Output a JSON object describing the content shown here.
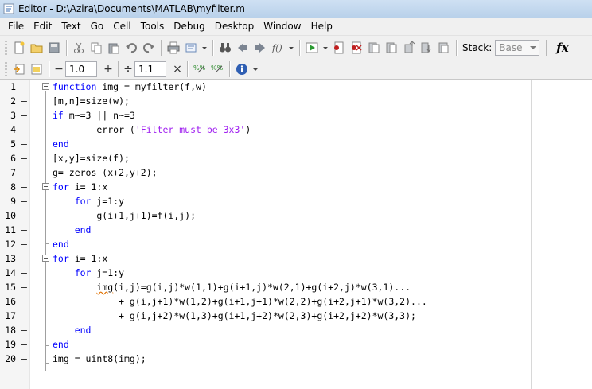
{
  "window": {
    "title": "Editor - D:\\Azira\\Documents\\MATLAB\\myfilter.m"
  },
  "menu": [
    {
      "label": "File"
    },
    {
      "label": "Edit"
    },
    {
      "label": "Text"
    },
    {
      "label": "Go"
    },
    {
      "label": "Cell"
    },
    {
      "label": "Tools"
    },
    {
      "label": "Debug"
    },
    {
      "label": "Desktop"
    },
    {
      "label": "Window"
    },
    {
      "label": "Help"
    }
  ],
  "toolbar": {
    "stack_label": "Stack:",
    "stack_value": "Base",
    "fx_label": "fx"
  },
  "cell_toolbar": {
    "minus_label": "−",
    "value1": "1.0",
    "plus_label": "+",
    "divide_label": "÷",
    "value2": "1.1",
    "times_label": "×"
  },
  "icons": {
    "new": "new-file-icon",
    "open": "open-folder-icon",
    "save": "save-icon",
    "cut": "cut-icon",
    "copy": "copy-icon",
    "paste": "paste-icon",
    "undo": "undo-icon",
    "redo": "redo-icon",
    "print": "print-icon",
    "find": "find-icon",
    "back": "back-icon",
    "forward": "forward-icon",
    "run": "run-icon",
    "set_breakpoint": "set-breakpoint-icon",
    "clear_breakpoints": "clear-breakpoints-icon",
    "step": "step-icon",
    "help": "help-icon"
  },
  "editor": {
    "lines": [
      {
        "n": "1",
        "bp": "",
        "text": "function img = myfilter(f,w)"
      },
      {
        "n": "2",
        "bp": "–",
        "text": "[m,n]=size(w);"
      },
      {
        "n": "3",
        "bp": "–",
        "text": "if m~=3 || n~=3"
      },
      {
        "n": "4",
        "bp": "–",
        "text": "        error ('Filter must be 3x3')"
      },
      {
        "n": "5",
        "bp": "–",
        "text": "end"
      },
      {
        "n": "6",
        "bp": "–",
        "text": "[x,y]=size(f);"
      },
      {
        "n": "7",
        "bp": "–",
        "text": "g= zeros (x+2,y+2);"
      },
      {
        "n": "8",
        "bp": "–",
        "text": "for i= 1:x"
      },
      {
        "n": "9",
        "bp": "–",
        "text": "    for j=1:y"
      },
      {
        "n": "10",
        "bp": "–",
        "text": "        g(i+1,j+1)=f(i,j);"
      },
      {
        "n": "11",
        "bp": "–",
        "text": "    end"
      },
      {
        "n": "12",
        "bp": "–",
        "text": "end"
      },
      {
        "n": "13",
        "bp": "–",
        "text": "for i= 1:x"
      },
      {
        "n": "14",
        "bp": "–",
        "text": "    for j=1:y"
      },
      {
        "n": "15",
        "bp": "–",
        "text": "        img(i,j)=g(i,j)*w(1,1)+g(i+1,j)*w(2,1)+g(i+2,j)*w(3,1)..."
      },
      {
        "n": "16",
        "bp": "",
        "text": "            + g(i,j+1)*w(1,2)+g(i+1,j+1)*w(2,2)+g(i+2,j+1)*w(3,2)..."
      },
      {
        "n": "17",
        "bp": "",
        "text": "            + g(i,j+2)*w(1,3)+g(i+1,j+2)*w(2,3)+g(i+2,j+2)*w(3,3);"
      },
      {
        "n": "18",
        "bp": "–",
        "text": "    end"
      },
      {
        "n": "19",
        "bp": "–",
        "text": "end"
      },
      {
        "n": "20",
        "bp": "–",
        "text": "img = uint8(img);"
      }
    ]
  }
}
